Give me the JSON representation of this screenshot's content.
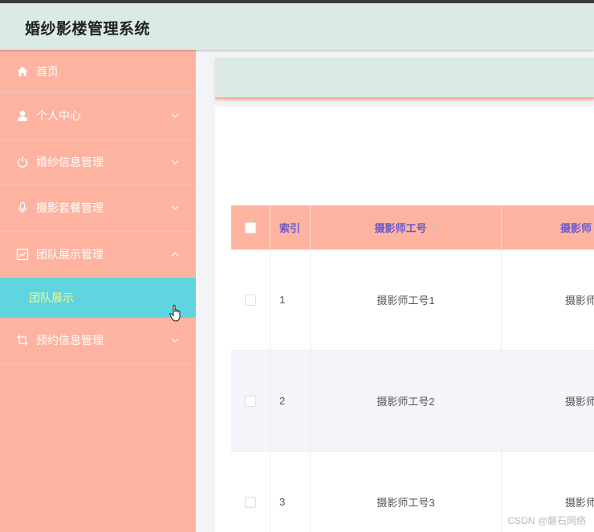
{
  "header": {
    "title": "婚纱影楼管理系统"
  },
  "sidebar": {
    "items": [
      {
        "label": "首页"
      },
      {
        "label": "个人中心"
      },
      {
        "label": "婚纱信息管理"
      },
      {
        "label": "摄影套餐管理"
      },
      {
        "label": "团队展示管理"
      },
      {
        "label": "预约信息管理"
      }
    ],
    "submenu": {
      "label": "团队展示"
    }
  },
  "table": {
    "headers": {
      "index": "索引",
      "photographer_id": "摄影师工号",
      "photographer_partial": "摄影师"
    },
    "rows": [
      {
        "index": "1",
        "photographer_id": "摄影师工号1",
        "partial": "摄影师"
      },
      {
        "index": "2",
        "photographer_id": "摄影师工号2",
        "partial": "摄影师"
      },
      {
        "index": "3",
        "photographer_id": "摄影师工号3",
        "partial": "摄影师"
      }
    ]
  },
  "watermark": "CSDN @磐石网络",
  "colors": {
    "sidebar": "#feb3a0",
    "header": "#dbeae4",
    "active_submenu": "#5fd5df",
    "active_text": "#f3f790",
    "header_text": "#6a5acd"
  }
}
